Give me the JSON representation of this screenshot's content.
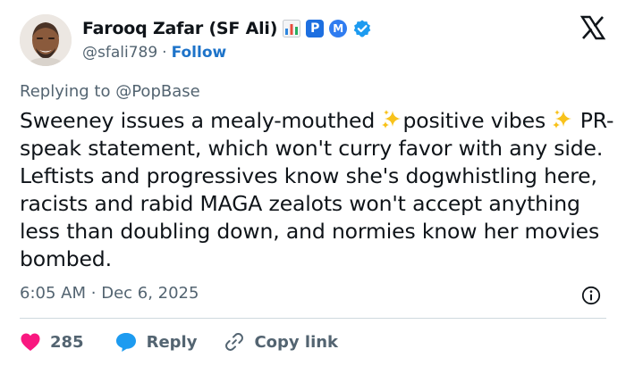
{
  "author": {
    "display_name": "Farooq Zafar (SF Ali)",
    "handle": "@sfali789",
    "separator": "·",
    "follow_label": "Follow",
    "badges": [
      "bar-chart-emoji",
      "p-badge",
      "m-badge",
      "verified-check"
    ],
    "badge_p_text": "P",
    "badge_m_text": "M"
  },
  "replying_to": {
    "prefix": "Replying to",
    "mention": "@PopBase"
  },
  "tweet": {
    "segments": [
      "Sweeney issues a mealy-mouthed ",
      "positive vibes ",
      " PR-speak statement, which won't curry favor with any side. Leftists and progressives know she's dogwhistling here, racists and rabid MAGA zealots won't accept anything less than doubling down, and normies know her movies bombed."
    ],
    "emoji": "sparkles"
  },
  "meta": {
    "time": "6:05 AM",
    "separator": "·",
    "date": "Dec 6, 2025"
  },
  "actions": {
    "like_count": "285",
    "reply_label": "Reply",
    "copy_label": "Copy link"
  },
  "colors": {
    "text": "#0f1419",
    "muted": "#536471",
    "link": "#1d73c9",
    "verified": "#1d9bf0",
    "like": "#f91880",
    "reply": "#1d9bf0"
  }
}
